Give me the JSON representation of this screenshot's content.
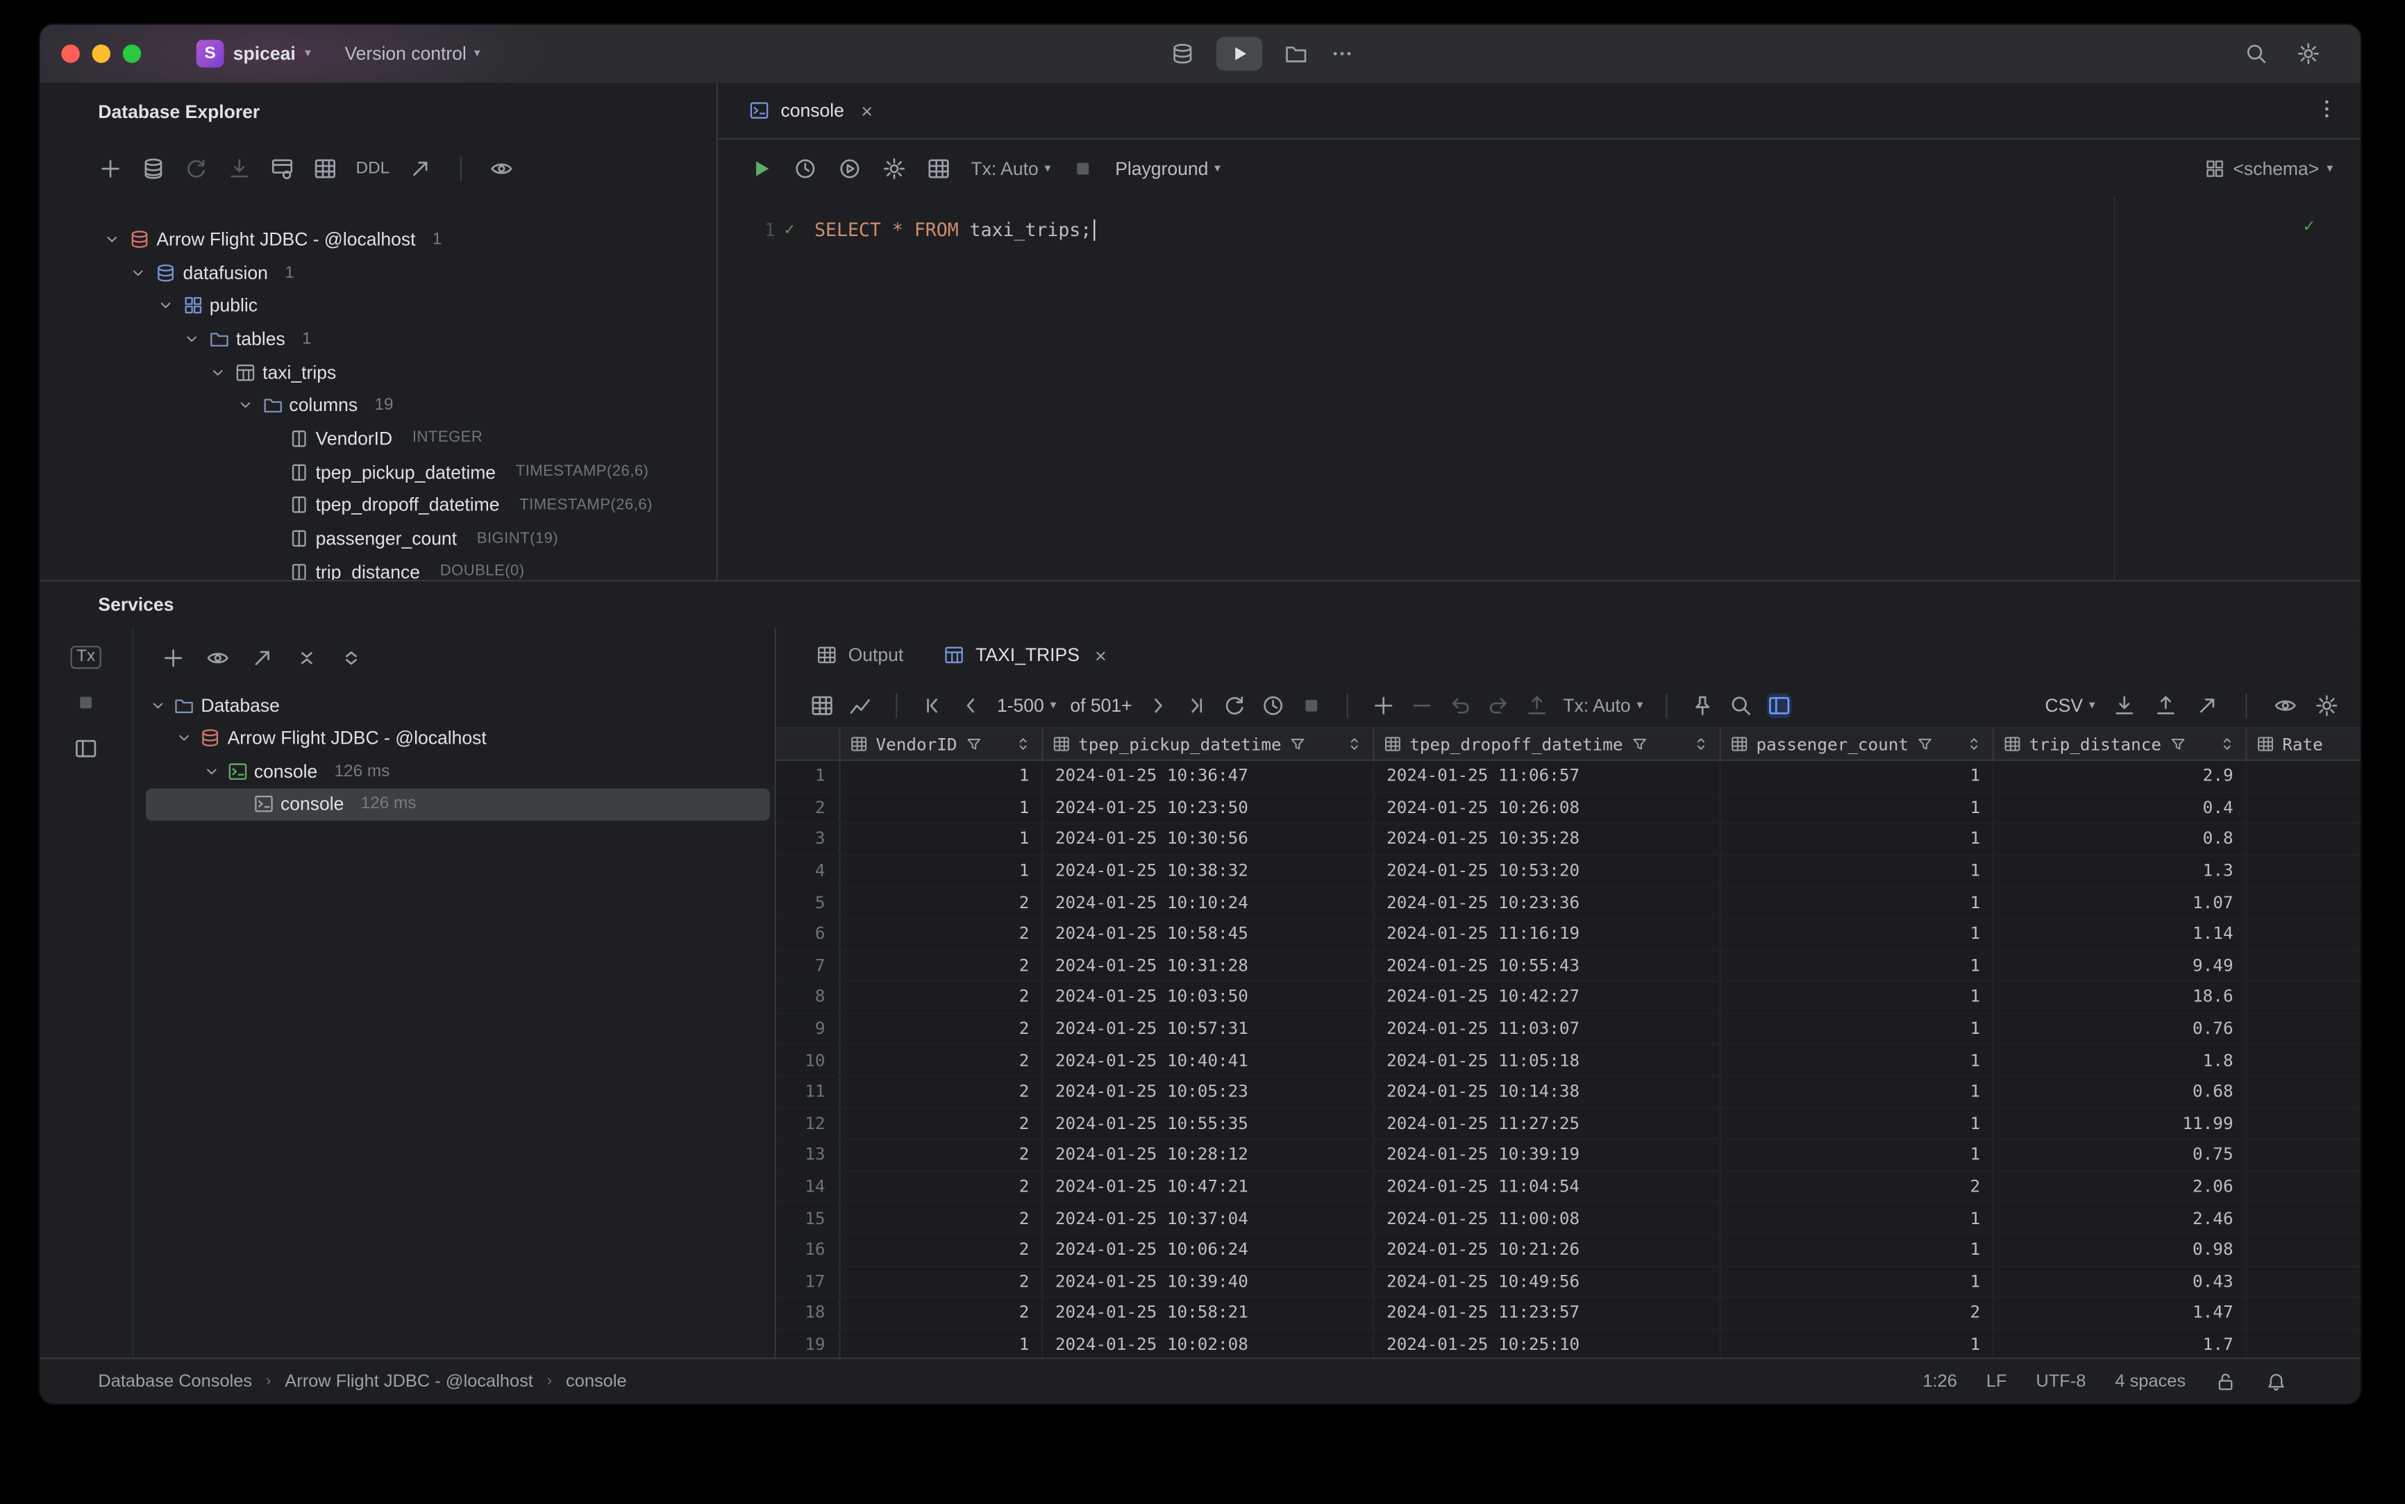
{
  "titlebar": {
    "project": "spiceai",
    "version_control": "Version control"
  },
  "explorer": {
    "title": "Database Explorer",
    "ddl": "DDL",
    "tree": [
      {
        "indent": 0,
        "chevron": "down",
        "icon": "db",
        "color": "c-red",
        "label": "Arrow Flight JDBC - @localhost",
        "badge": "1"
      },
      {
        "indent": 1,
        "chevron": "down",
        "icon": "db",
        "color": "c-blue",
        "label": "datafusion",
        "badge": "1"
      },
      {
        "indent": 2,
        "chevron": "down",
        "icon": "schema",
        "color": "c-blue",
        "label": "public",
        "badge": ""
      },
      {
        "indent": 3,
        "chevron": "down",
        "icon": "folder",
        "color": "c-folder",
        "label": "tables",
        "badge": "1"
      },
      {
        "indent": 4,
        "chevron": "down",
        "icon": "table",
        "color": "",
        "label": "taxi_trips",
        "badge": ""
      },
      {
        "indent": 5,
        "chevron": "down",
        "icon": "folder",
        "color": "c-folder",
        "label": "columns",
        "badge": "19"
      },
      {
        "indent": 6,
        "chevron": "none",
        "icon": "column",
        "color": "",
        "label": "VendorID",
        "type": "INTEGER"
      },
      {
        "indent": 6,
        "chevron": "none",
        "icon": "column",
        "color": "",
        "label": "tpep_pickup_datetime",
        "type": "TIMESTAMP(26,6)"
      },
      {
        "indent": 6,
        "chevron": "none",
        "icon": "column",
        "color": "",
        "label": "tpep_dropoff_datetime",
        "type": "TIMESTAMP(26,6)"
      },
      {
        "indent": 6,
        "chevron": "none",
        "icon": "column",
        "color": "",
        "label": "passenger_count",
        "type": "BIGINT(19)"
      },
      {
        "indent": 6,
        "chevron": "none",
        "icon": "column",
        "color": "",
        "label": "trip_distance",
        "type": "DOUBLE(0)"
      }
    ]
  },
  "editor": {
    "tab": "console",
    "tx": "Tx: Auto",
    "playground": "Playground",
    "schema": "<schema>",
    "line": "1",
    "sql": [
      {
        "t": "SELECT",
        "c": "kw"
      },
      {
        "t": " ",
        "c": "pl"
      },
      {
        "t": "*",
        "c": "kw"
      },
      {
        "t": " ",
        "c": "pl"
      },
      {
        "t": "FROM",
        "c": "kw"
      },
      {
        "t": " ",
        "c": "pl"
      },
      {
        "t": "taxi_trips",
        "c": "id"
      },
      {
        "t": ";",
        "c": "pl"
      }
    ]
  },
  "services": {
    "title": "Services",
    "tabs": {
      "output": "Output",
      "result": "TAXI_TRIPS"
    },
    "tree": [
      {
        "indent": 0,
        "chevron": "down",
        "icon": "folder",
        "color": "c-folder",
        "label": "Database",
        "meta": ""
      },
      {
        "indent": 1,
        "chevron": "down",
        "icon": "db",
        "color": "c-red",
        "label": "Arrow Flight JDBC - @localhost",
        "meta": ""
      },
      {
        "indent": 2,
        "chevron": "down",
        "icon": "console",
        "color": "c-green",
        "label": "console",
        "meta": "126 ms",
        "selected": false
      },
      {
        "indent": 3,
        "chevron": "none",
        "icon": "console",
        "color": "",
        "label": "console",
        "meta": "126 ms",
        "selected": true
      }
    ]
  },
  "grid": {
    "pager_range": "1-500",
    "pager_total": "of 501+",
    "tx": "Tx: Auto",
    "format": "CSV",
    "columns": [
      {
        "name": "VendorID",
        "align": "right"
      },
      {
        "name": "tpep_pickup_datetime",
        "align": "left"
      },
      {
        "name": "tpep_dropoff_datetime",
        "align": "left"
      },
      {
        "name": "passenger_count",
        "align": "right"
      },
      {
        "name": "trip_distance",
        "align": "right"
      },
      {
        "name": "Rate",
        "align": "left"
      }
    ],
    "rows": [
      [
        "1",
        "2024-01-25 10:36:47",
        "2024-01-25 11:06:57",
        "1",
        "2.9",
        ""
      ],
      [
        "1",
        "2024-01-25 10:23:50",
        "2024-01-25 10:26:08",
        "1",
        "0.4",
        ""
      ],
      [
        "1",
        "2024-01-25 10:30:56",
        "2024-01-25 10:35:28",
        "1",
        "0.8",
        ""
      ],
      [
        "1",
        "2024-01-25 10:38:32",
        "2024-01-25 10:53:20",
        "1",
        "1.3",
        ""
      ],
      [
        "2",
        "2024-01-25 10:10:24",
        "2024-01-25 10:23:36",
        "1",
        "1.07",
        ""
      ],
      [
        "2",
        "2024-01-25 10:58:45",
        "2024-01-25 11:16:19",
        "1",
        "1.14",
        ""
      ],
      [
        "2",
        "2024-01-25 10:31:28",
        "2024-01-25 10:55:43",
        "1",
        "9.49",
        ""
      ],
      [
        "2",
        "2024-01-25 10:03:50",
        "2024-01-25 10:42:27",
        "1",
        "18.6",
        ""
      ],
      [
        "2",
        "2024-01-25 10:57:31",
        "2024-01-25 11:03:07",
        "1",
        "0.76",
        ""
      ],
      [
        "2",
        "2024-01-25 10:40:41",
        "2024-01-25 11:05:18",
        "1",
        "1.8",
        ""
      ],
      [
        "2",
        "2024-01-25 10:05:23",
        "2024-01-25 10:14:38",
        "1",
        "0.68",
        ""
      ],
      [
        "2",
        "2024-01-25 10:55:35",
        "2024-01-25 11:27:25",
        "1",
        "11.99",
        ""
      ],
      [
        "2",
        "2024-01-25 10:28:12",
        "2024-01-25 10:39:19",
        "1",
        "0.75",
        ""
      ],
      [
        "2",
        "2024-01-25 10:47:21",
        "2024-01-25 11:04:54",
        "2",
        "2.06",
        ""
      ],
      [
        "2",
        "2024-01-25 10:37:04",
        "2024-01-25 11:00:08",
        "1",
        "2.46",
        ""
      ],
      [
        "2",
        "2024-01-25 10:06:24",
        "2024-01-25 10:21:26",
        "1",
        "0.98",
        ""
      ],
      [
        "2",
        "2024-01-25 10:39:40",
        "2024-01-25 10:49:56",
        "1",
        "0.43",
        ""
      ],
      [
        "2",
        "2024-01-25 10:58:21",
        "2024-01-25 11:23:57",
        "2",
        "1.47",
        ""
      ],
      [
        "1",
        "2024-01-25 10:02:08",
        "2024-01-25 10:25:10",
        "1",
        "1.7",
        ""
      ]
    ]
  },
  "status": {
    "crumbs": [
      "Database Consoles",
      "Arrow Flight JDBC - @localhost",
      "console"
    ],
    "caret": "1:26",
    "eol": "LF",
    "encoding": "UTF-8",
    "indent": "4 spaces"
  }
}
